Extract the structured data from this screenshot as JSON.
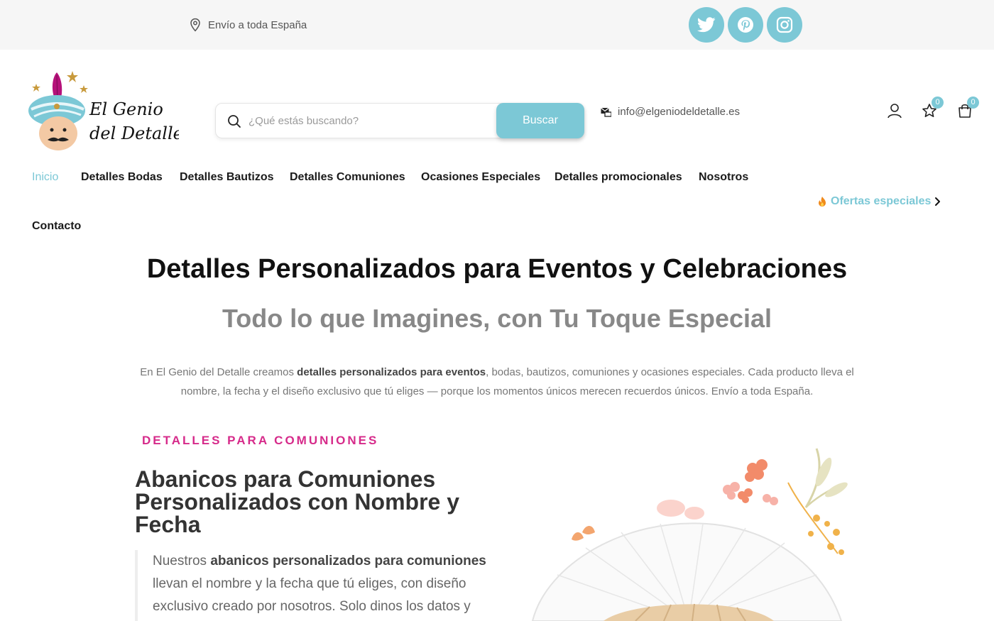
{
  "topbar": {
    "shipping_text": "Envío a toda España",
    "shipping_icon": "map-pin-icon",
    "social": [
      {
        "name": "twitter",
        "icon": "twitter-icon"
      },
      {
        "name": "pinterest",
        "icon": "pinterest-icon"
      },
      {
        "name": "instagram",
        "icon": "instagram-icon"
      }
    ],
    "bg_color": "#f6f6f6",
    "accent": "#7cc8d6"
  },
  "header": {
    "logo_text_line1": "El Genio",
    "logo_text_line2": "del Detalle",
    "search": {
      "placeholder": "¿Qué estás buscando?",
      "button_label": "Buscar"
    },
    "email": "info@elgeniodeldetalle.es",
    "wishlist_count": "0",
    "cart_count": "0"
  },
  "nav": {
    "items": [
      {
        "label": "Inicio",
        "active": true
      },
      {
        "label": "Detalles Bodas"
      },
      {
        "label": "Detalles Bautizos"
      },
      {
        "label": "Detalles Comuniones"
      },
      {
        "label": "Ocasiones Especiales"
      },
      {
        "label": "Detalles promocionales"
      },
      {
        "label": "Nosotros"
      },
      {
        "label": "Contacto"
      }
    ],
    "offers_label": "Ofertas especiales"
  },
  "hero": {
    "title": "Detalles Personalizados para Eventos y Celebraciones",
    "subtitle": "Todo lo que Imagines, con Tu Toque Especial",
    "intro_before": "En El Genio del Detalle creamos ",
    "intro_bold": "detalles personalizados para eventos",
    "intro_after": ", bodas, bautizos, comuniones y ocasiones especiales. Cada producto lleva el nombre, la fecha y el diseño exclusivo que tú eliges — porque los momentos únicos merecen recuerdos únicos. Envío a toda España."
  },
  "feature": {
    "eyebrow": "DETALLES PARA COMUNIONES",
    "title": "Abanicos para Comuniones Personalizados con Nombre y Fecha",
    "quote_before": "Nuestros ",
    "quote_bold": "abanicos personalizados para comuniones",
    "quote_after": " llevan el nombre y la fecha que tú eliges, con diseño exclusivo creado por nosotros. Solo dinos los datos y"
  },
  "colors": {
    "accent": "#7cc8d6",
    "eyebrow_pink": "#d62a8a"
  }
}
